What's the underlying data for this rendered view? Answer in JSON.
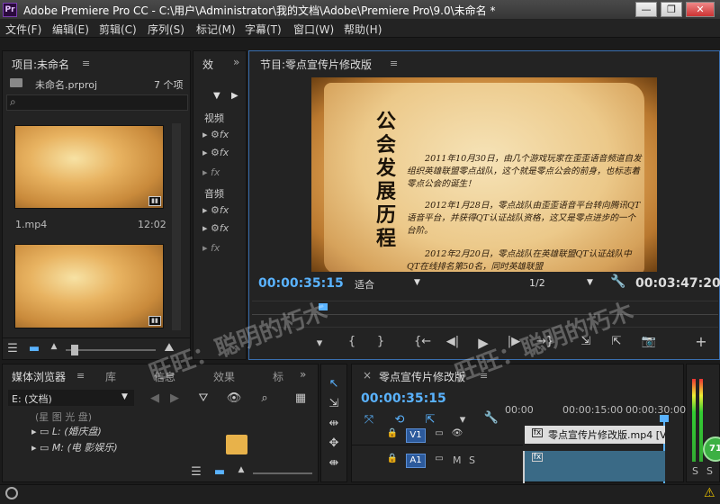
{
  "window": {
    "app_icon": "Pr",
    "title": "Adobe Premiere Pro CC - C:\\用户\\Administrator\\我的文档\\Adobe\\Premiere Pro\\9.0\\未命名 *",
    "minimize": "—",
    "restore": "❐",
    "close": "✕"
  },
  "menu": [
    "文件(F)",
    "编辑(E)",
    "剪辑(C)",
    "序列(S)",
    "标记(M)",
    "字幕(T)",
    "窗口(W)",
    "帮助(H)"
  ],
  "project": {
    "title": "项目:未命名",
    "menu_icon": "≡",
    "file": "未命名.prproj",
    "count": "7 个项",
    "clips": [
      {
        "name": "1.mp4",
        "duration": "12:02"
      }
    ],
    "expand_icon": "»"
  },
  "effects": {
    "tab": "效",
    "group_video": "视频",
    "group_audio": "音频",
    "fx": "fx"
  },
  "program": {
    "title": "节目:零点宣传片修改版",
    "menu_icon": "≡",
    "timecode": "00:00:35:15",
    "fit": "适合",
    "resolution": "1/2",
    "duration": "00:03:47:20",
    "frame": {
      "heading": "公会发展历程",
      "paragraphs": [
        "2011年10月30日，由几个游戏玩家在歪歪语音频道自发组织英雄联盟零点战队，这个就是零点公会的前身，也标志着零点公会的诞生！",
        "2012年1月28日，零点战队由歪歪语音平台转向腾讯QT语音平台，并获得QT认证战队资格，这又是零点进步的一个台阶。",
        "2012年2月20日，零点战队在英雄联盟QT认证战队中QT在线排名第50名，同时英雄联盟"
      ]
    },
    "transport": [
      "▾",
      "{",
      "}",
      "{←",
      "◀|",
      "▶",
      "|▶",
      "→}",
      "⇲",
      "⇱",
      "📷",
      "+"
    ]
  },
  "media": {
    "tabs": [
      "媒体浏览器",
      "库",
      "信息",
      "效果",
      "标"
    ],
    "drive": "E: (文档)",
    "items": [
      "(星 图 光 盘)",
      "L: (婚庆盘)",
      "M: (电 影娱乐)"
    ]
  },
  "timeline": {
    "close": "×",
    "title": "零点宣传片修改版",
    "menu_icon": "≡",
    "timecode": "00:00:35:15",
    "ruler": [
      "00:00",
      "00:00:15:00",
      "00:00:30:00"
    ],
    "tracks": [
      {
        "id": "V1",
        "clip": "零点宣传片修改版.mp4 [V]"
      },
      {
        "id": "A1",
        "m": "M",
        "s": "S"
      }
    ]
  },
  "audio_meter": {
    "value": "71",
    "s_labels": [
      "S",
      "S"
    ]
  },
  "watermark": "旺旺：聪明的朽木",
  "colors": {
    "accent": "#5ab3ff",
    "track_blue": "#2c5a9c",
    "panel": "#232323"
  }
}
